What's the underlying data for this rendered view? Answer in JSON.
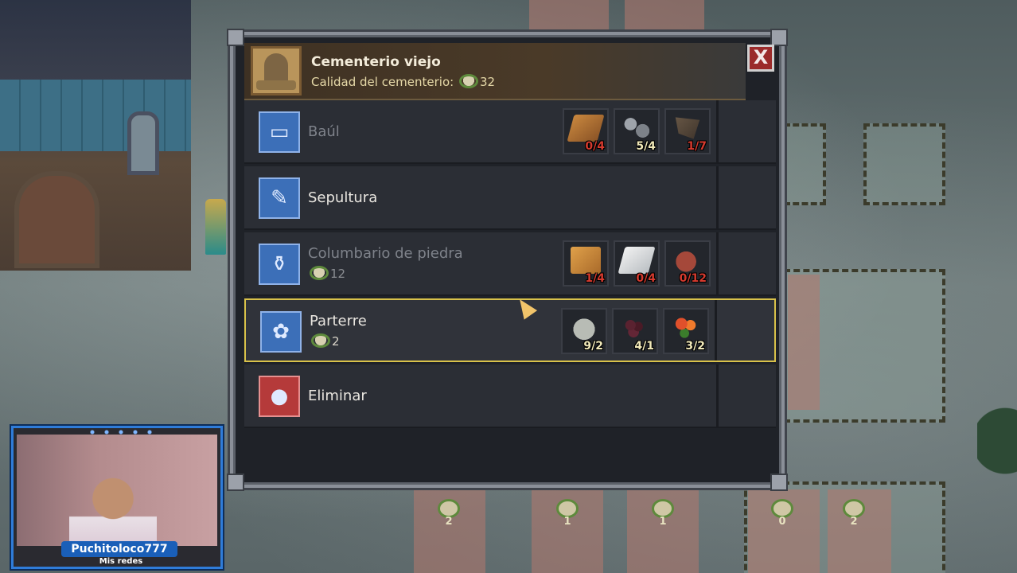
{
  "dialog": {
    "title": "Cementerio viejo",
    "quality_label": "Calidad del cementerio:",
    "quality_value": "32",
    "close_label": "X",
    "rows": [
      {
        "name": "Baúl",
        "icon": "chest-blueprint-icon",
        "available": false,
        "materials": [
          {
            "icon": "wood-plank-icon",
            "count": "0/4",
            "ok": false
          },
          {
            "icon": "nails-icon",
            "count": "5/4",
            "ok": true
          },
          {
            "icon": "iron-hinge-icon",
            "count": "1/7",
            "ok": false
          }
        ]
      },
      {
        "name": "Sepultura",
        "icon": "grave-blueprint-icon",
        "available": true,
        "materials": []
      },
      {
        "name": "Columbario de piedra",
        "icon": "urn-blueprint-icon",
        "available": false,
        "quality": "12",
        "materials": [
          {
            "icon": "wood-plank-icon",
            "count": "1/4",
            "ok": false
          },
          {
            "icon": "marble-icon",
            "count": "0/4",
            "ok": false
          },
          {
            "icon": "clay-vase-icon",
            "count": "0/12",
            "ok": false
          }
        ]
      },
      {
        "name": "Parterre",
        "icon": "flowerbed-blueprint-icon",
        "available": true,
        "selected": true,
        "quality": "2",
        "materials": [
          {
            "icon": "stone-icon",
            "count": "9/2",
            "ok": true
          },
          {
            "icon": "berries-icon",
            "count": "4/1",
            "ok": true
          },
          {
            "icon": "flower-icon",
            "count": "3/2",
            "ok": true
          }
        ]
      },
      {
        "name": "Eliminar",
        "icon": "wrecking-ball-icon",
        "available": true,
        "materials": []
      }
    ]
  },
  "map": {
    "markers": [
      "2",
      "1",
      "1",
      "0",
      "2"
    ]
  },
  "webcam": {
    "username": "Puchitoloco777",
    "social": "Mis redes"
  },
  "colors": {
    "accent_selected": "#d9c24a",
    "insufficient": "#d63a2e",
    "sufficient": "#f1e9b9"
  }
}
